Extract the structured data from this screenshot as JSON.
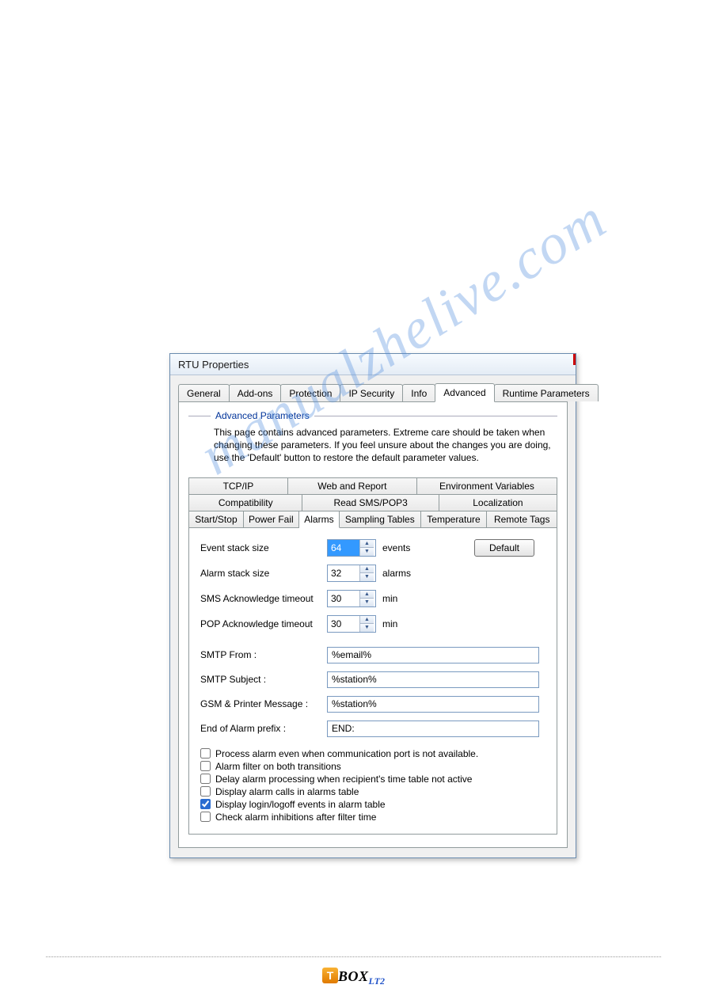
{
  "watermark": "manualzhelive.com",
  "dialog": {
    "title": "RTU Properties",
    "tabs": [
      "General",
      "Add-ons",
      "Protection",
      "IP Security",
      "Info",
      "Advanced",
      "Runtime Parameters"
    ],
    "active_tab": "Advanced",
    "group_title": "Advanced Parameters",
    "intro": "This page contains advanced parameters. Extreme care should be taken when changing these parameters. If you feel unsure about the changes you are doing, use the 'Default' button to restore the default parameter values.",
    "subtabs_row1": [
      "TCP/IP",
      "Web and Report",
      "Environment Variables"
    ],
    "subtabs_row2": [
      "Compatibility",
      "Read SMS/POP3",
      "Localization"
    ],
    "subtabs_row3": [
      "Start/Stop",
      "Power Fail",
      "Alarms",
      "Sampling Tables",
      "Temperature",
      "Remote Tags"
    ],
    "active_subtab": "Alarms",
    "default_button": "Default",
    "fields": {
      "event_stack": {
        "label": "Event stack size",
        "value": "64",
        "unit": "events"
      },
      "alarm_stack": {
        "label": "Alarm stack size",
        "value": "32",
        "unit": "alarms"
      },
      "sms_ack": {
        "label": "SMS Acknowledge timeout",
        "value": "30",
        "unit": "min"
      },
      "pop_ack": {
        "label": "POP Acknowledge timeout",
        "value": "30",
        "unit": "min"
      },
      "smtp_from": {
        "label": "SMTP  From :",
        "value": "%email%"
      },
      "smtp_subj": {
        "label": "SMTP  Subject :",
        "value": "%station%"
      },
      "gsm_msg": {
        "label": "GSM & Printer Message :",
        "value": "%station%"
      },
      "end_prefix": {
        "label": "End of Alarm prefix :",
        "value": "END:"
      }
    },
    "checks": [
      {
        "label": "Process alarm even when communication port is not available.",
        "checked": false
      },
      {
        "label": "Alarm filter on both transitions",
        "checked": false
      },
      {
        "label": "Delay alarm processing when recipient's time table not active",
        "checked": false
      },
      {
        "label": "Display alarm calls in alarms table",
        "checked": false
      },
      {
        "label": "Display login/logoff events in alarm table",
        "checked": true
      },
      {
        "label": "Check alarm inhibitions after filter time",
        "checked": false
      }
    ]
  },
  "footer": {
    "t": "T",
    "box": "BOX",
    "lt2": "LT2"
  }
}
